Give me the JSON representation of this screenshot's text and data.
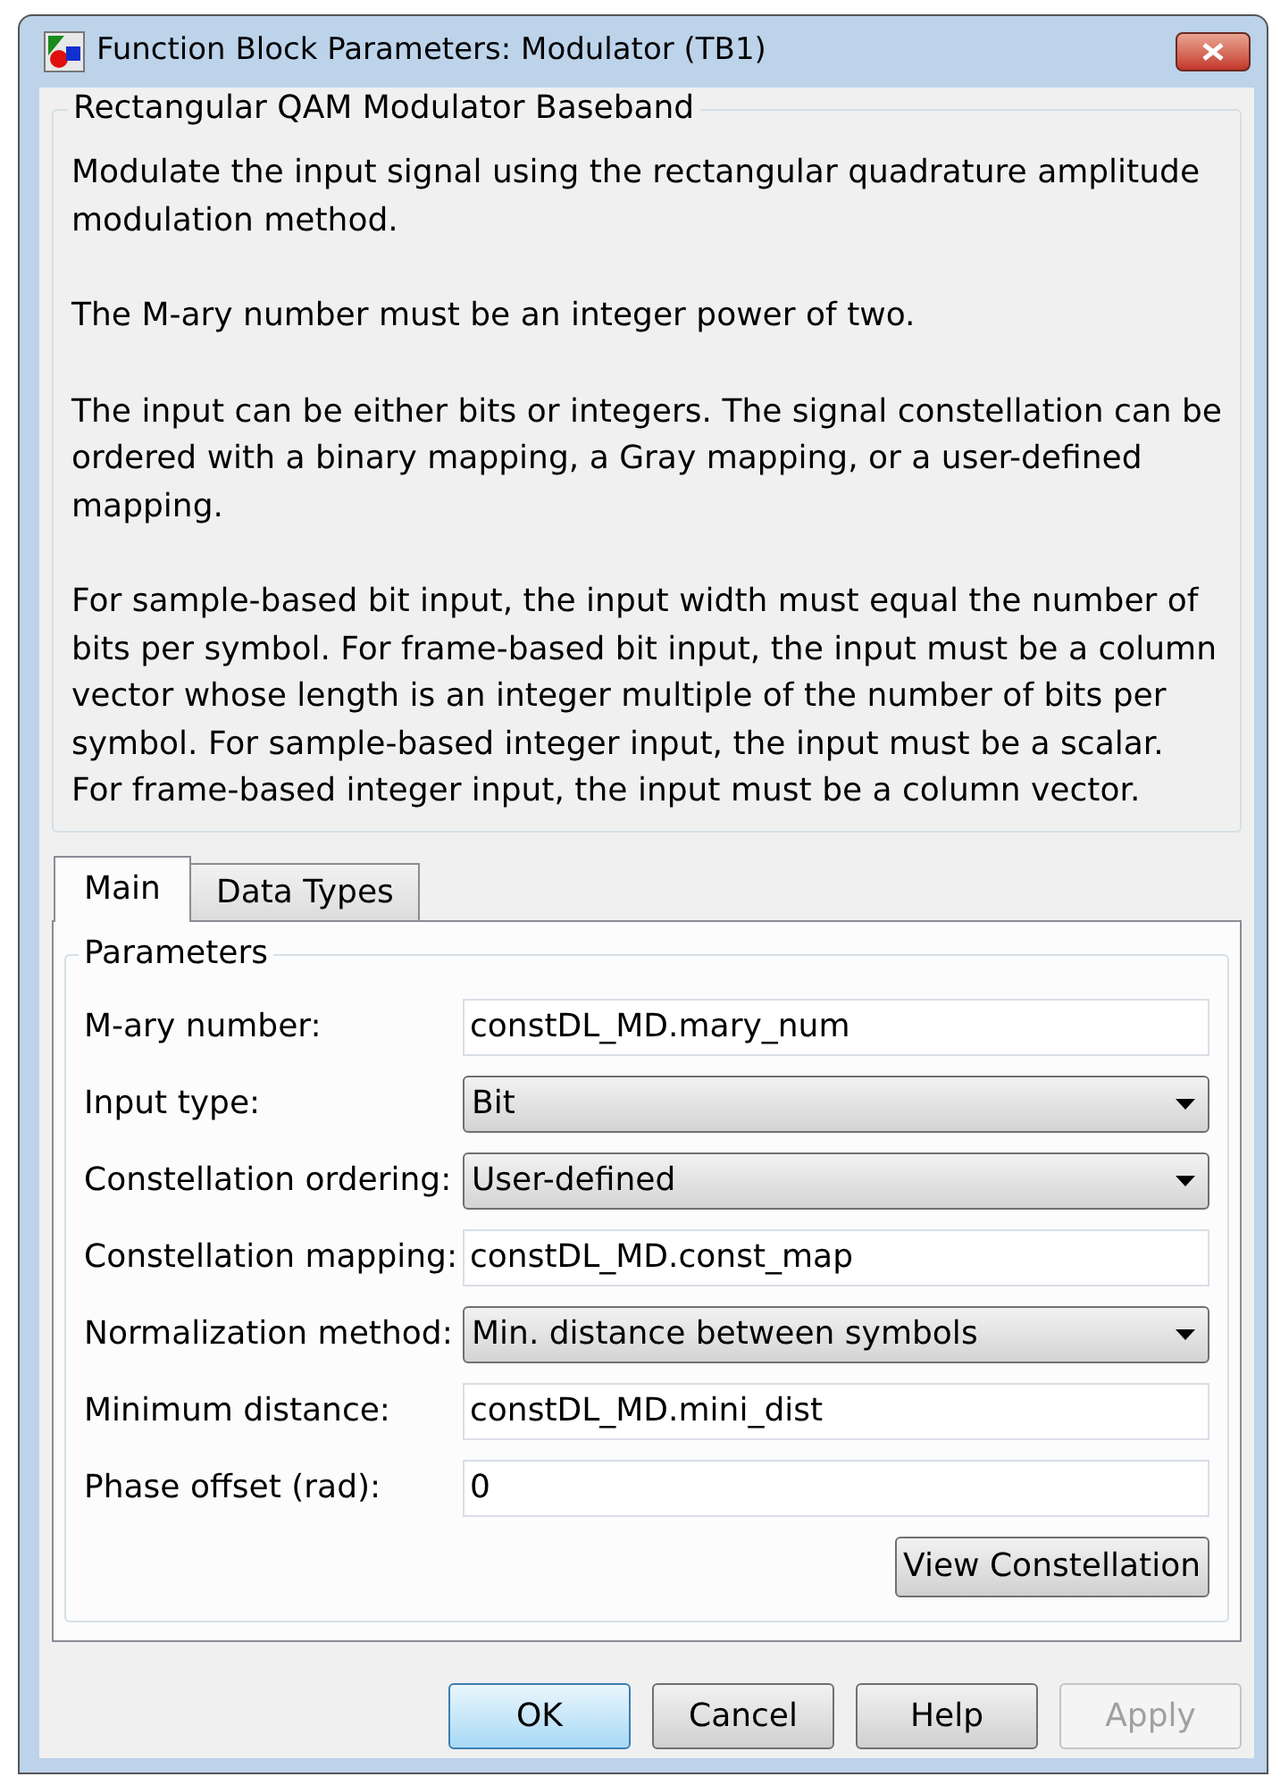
{
  "window": {
    "title": "Function Block Parameters: Modulator (TB1)"
  },
  "block": {
    "title": "Rectangular QAM Modulator Baseband",
    "description": [
      "Modulate the input signal using the rectangular quadrature amplitude modulation method.",
      "The M-ary number must be an integer power of two.",
      "The input can be either bits or integers. The signal constellation can be ordered with a binary mapping, a Gray mapping, or a user-defined mapping.",
      "For sample-based bit input, the input width must equal the number of bits per symbol. For frame-based bit input, the input must be a column vector whose length is an integer multiple of the number of bits per symbol. For sample-based integer input, the input must be a scalar. For frame-based integer input, the input must be a column vector."
    ]
  },
  "tabs": [
    {
      "label": "Main",
      "selected": true
    },
    {
      "label": "Data Types",
      "selected": false
    }
  ],
  "parameters": {
    "title": "Parameters",
    "rows": [
      {
        "label": "M-ary number:",
        "kind": "field",
        "value": "constDL_MD.mary_num"
      },
      {
        "label": "Input type:",
        "kind": "dropdown",
        "value": "Bit"
      },
      {
        "label": "Constellation ordering:",
        "kind": "dropdown",
        "value": "User-defined"
      },
      {
        "label": "Constellation mapping:",
        "kind": "field",
        "value": "constDL_MD.const_map"
      },
      {
        "label": "Normalization method:",
        "kind": "dropdown",
        "value": "Min. distance between symbols"
      },
      {
        "label": "Minimum distance:",
        "kind": "field",
        "value": "constDL_MD.mini_dist"
      },
      {
        "label": "Phase offset (rad):",
        "kind": "field",
        "value": "0"
      }
    ],
    "button": "View Constellation"
  },
  "buttons": [
    {
      "label": "OK",
      "default": true,
      "disabled": false
    },
    {
      "label": "Cancel",
      "default": false,
      "disabled": false
    },
    {
      "label": "Help",
      "default": false,
      "disabled": false
    },
    {
      "label": "Apply",
      "default": false,
      "disabled": true
    }
  ]
}
